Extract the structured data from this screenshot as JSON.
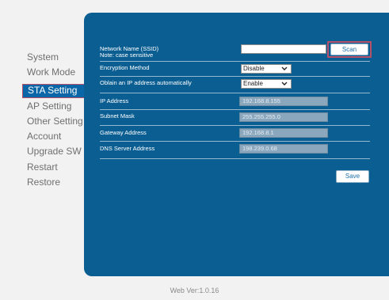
{
  "sidebar": {
    "items": [
      {
        "label": "System"
      },
      {
        "label": "Work Mode"
      },
      {
        "label": "STA Setting"
      },
      {
        "label": "AP Setting"
      },
      {
        "label": "Other Setting"
      },
      {
        "label": "Account"
      },
      {
        "label": "Upgrade SW"
      },
      {
        "label": "Restart"
      },
      {
        "label": "Restore"
      }
    ]
  },
  "sta": {
    "ssid": {
      "label": "Network Name  (SSID)",
      "note": "Note: case sensitive",
      "value": ""
    },
    "scan_label": "Scan",
    "encryption": {
      "label": "Encryption Method",
      "value": "Disable"
    },
    "dhcp": {
      "label": "Oblain an IP address automatically",
      "value": "Enable"
    },
    "ip": {
      "label": "IP Address",
      "value": "192.168.8.155"
    },
    "mask": {
      "label": "Subnet Mask",
      "value": "255.255.255.0"
    },
    "gateway": {
      "label": "Gateway Address",
      "value": "192.168.8.1"
    },
    "dns": {
      "label": "DNS Server Address",
      "value": "198.239.0.68"
    },
    "save_label": "Save"
  },
  "footer": {
    "version": "Web Ver:1.0.16"
  },
  "colors": {
    "page_bg": "#f2f2f2",
    "panel": "#0b5e92",
    "active_nav": "#0b66a7",
    "highlight_border": "#b7506a",
    "readonly_field": "#8aa7bd"
  }
}
